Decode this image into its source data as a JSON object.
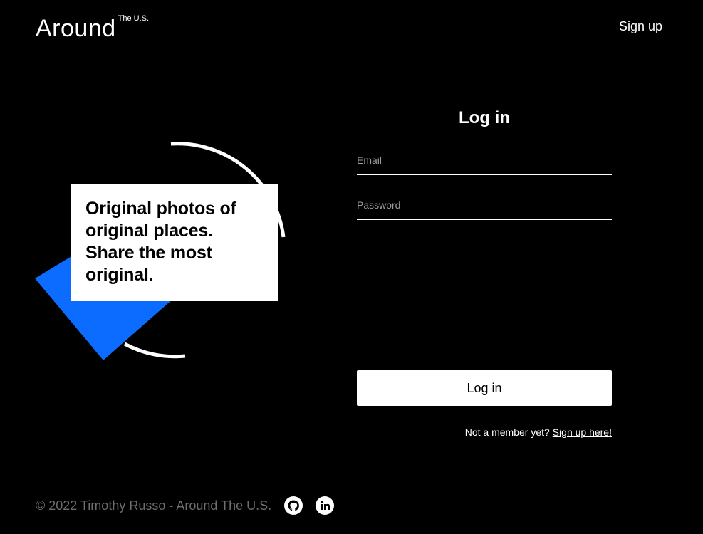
{
  "header": {
    "logo_main": "Around",
    "logo_sup": "The U.S.",
    "signup_link": "Sign up"
  },
  "hero": {
    "tagline": "Original photos of original places. Share the most original."
  },
  "login": {
    "title": "Log in",
    "email_placeholder": "Email",
    "password_placeholder": "Password",
    "submit_label": "Log in",
    "prompt_text": "Not a member yet?",
    "prompt_link": "Sign up here!"
  },
  "footer": {
    "copyright": "© 2022 Timothy Russo - Around The U.S.",
    "icons": [
      "github-icon",
      "linkedin-icon"
    ]
  },
  "colors": {
    "background": "#000000",
    "text": "#ffffff",
    "accent_blue": "#0b6cff",
    "muted": "#6e6e6e",
    "divider": "#8a8a8a"
  }
}
